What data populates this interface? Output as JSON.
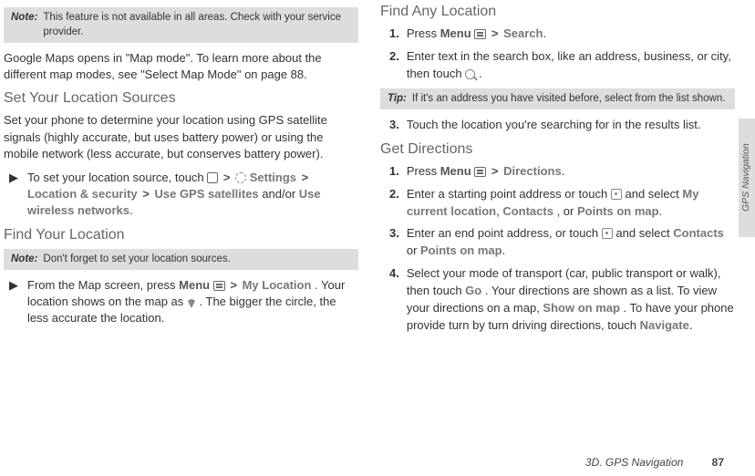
{
  "col1": {
    "note1_label": "Note:",
    "note1_text": "This feature is not available in all areas. Check with your service provider.",
    "p1": "Google Maps opens in \"Map mode\". To learn more about the different map modes, see \"Select Map Mode\" on page 88.",
    "h1": "Set Your Location Sources",
    "p2": "Set your phone to determine your location using GPS satellite signals (highly accurate, but uses battery power) or using the mobile network (less accurate, but conserves battery power).",
    "bullet1_pre": "To set your location source, touch ",
    "bullet1_settings": "Settings",
    "bullet1_locsec": "Location & security",
    "bullet1_usegps": "Use GPS satellites",
    "bullet1_andor": " and/or ",
    "bullet1_usewireless": "Use wireless networks",
    "h2": "Find Your Location",
    "note2_label": "Note:",
    "note2_text": "Don't forget to set your location sources.",
    "bullet2_pre": "From the Map screen, press ",
    "bullet2_menu": "Menu",
    "bullet2_myloc": "My Location",
    "bullet2_mid": ". Your location shows on the map as ",
    "bullet2_post": ". The bigger the circle, the less accurate the location."
  },
  "col2": {
    "h1": "Find Any Location",
    "step1a_pre": "Press ",
    "step1a_menu": "Menu",
    "step1a_search": "Search",
    "step2a": "Enter text in the search box, like an address, business, or city, then touch ",
    "tip_label": "Tip:",
    "tip_text": "If it's an address you have visited before, select from the list shown.",
    "step3a": "Touch the location you're searching for in the results list.",
    "h2": "Get Directions",
    "step1b_pre": "Press ",
    "step1b_menu": "Menu",
    "step1b_dir": "Directions",
    "step2b_pre": "Enter a starting point address or touch ",
    "step2b_mid": " and select ",
    "step2b_mycur": "My current location",
    "step2b_contacts": "Contacts",
    "step2b_or": ", or ",
    "step2b_points": "Points on map",
    "step3b_pre": "Enter an end point address, or touch ",
    "step3b_mid": " and select ",
    "step3b_contacts": "Contacts",
    "step3b_or": " or ",
    "step3b_points": "Points on map",
    "step4b_pre": "Select your mode of transport (car, public transport or walk), then touch ",
    "step4b_go": "Go",
    "step4b_mid1": ". Your directions are shown as a list. To view your directions on a map, ",
    "step4b_show": "Show on map",
    "step4b_mid2": ". To have your phone provide turn by turn driving directions, touch ",
    "step4b_nav": "Navigate"
  },
  "sidebar": {
    "label": "GPS Navigation"
  },
  "footer": {
    "section": "3D. GPS Navigation",
    "page": "87"
  }
}
